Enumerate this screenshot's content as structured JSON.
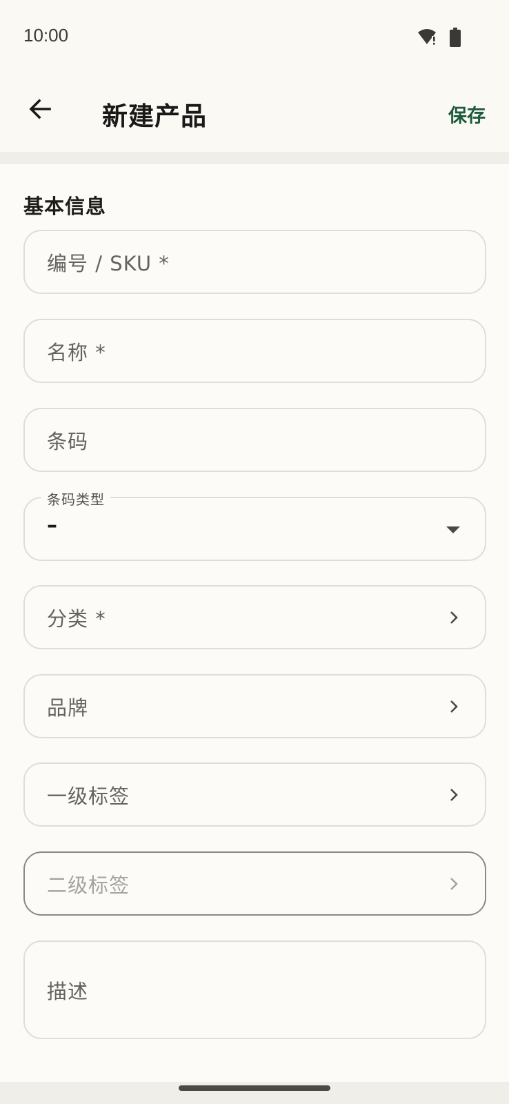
{
  "status_bar": {
    "time": "10:00"
  },
  "app_bar": {
    "title": "新建产品",
    "save_label": "保存"
  },
  "section": {
    "title": "基本信息"
  },
  "fields": {
    "sku_placeholder": "编号 / SKU *",
    "name_placeholder": "名称 *",
    "barcode_placeholder": "条码",
    "barcode_type_label": "条码类型",
    "barcode_type_value": "–",
    "category_placeholder": "分类 *",
    "brand_placeholder": "品牌",
    "tag1_placeholder": "一级标签",
    "tag2_placeholder": "二级标签",
    "description_placeholder": "描述"
  },
  "colors": {
    "accent": "#1d5b3c",
    "background": "#fcfbf8",
    "border": "#deddd8"
  },
  "icons": {
    "back": "arrow-back-icon",
    "wifi": "wifi-icon",
    "battery": "battery-icon",
    "chevron": "chevron-right-icon",
    "dropdown": "dropdown-arrow-icon"
  }
}
